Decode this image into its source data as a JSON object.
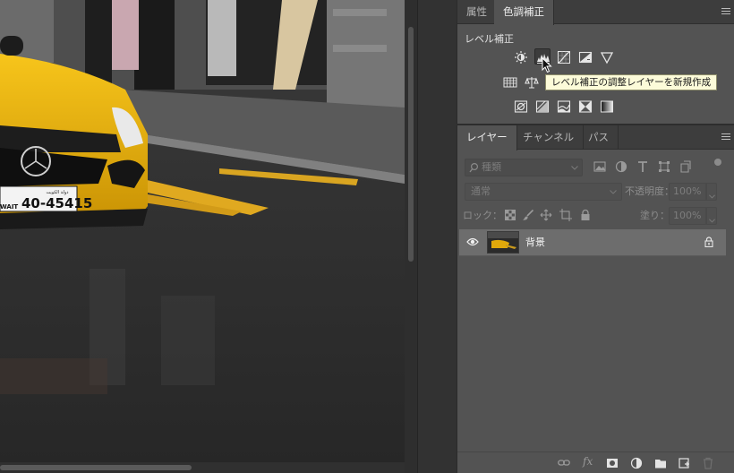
{
  "canvas": {
    "plate_text": "40-45415",
    "plate_prefix": "WAIT",
    "plate_arabic": "دولة الكويت"
  },
  "adjustments_panel": {
    "tabs": [
      {
        "label": "属性",
        "active": false
      },
      {
        "label": "色調補正",
        "active": true
      }
    ],
    "section_title": "レベル補正",
    "icons_row1": [
      "brightness-contrast-icon",
      "levels-icon",
      "curves-icon",
      "exposure-icon",
      "gradient-map-triangle-icon"
    ],
    "icons_row2": [
      "hue-saturation-icon",
      "color-balance-icon"
    ],
    "icons_row3": [
      "photo-filter-icon",
      "channel-mixer-icon",
      "color-lookup-icon",
      "invert-icon",
      "posterize-icon"
    ],
    "hovered_icon": "levels-icon",
    "tooltip": "レベル補正の調整レイヤーを新規作成"
  },
  "layers_panel": {
    "tabs": [
      {
        "label": "レイヤー",
        "active": true
      },
      {
        "label": "チャンネル",
        "active": false
      },
      {
        "label": "パス",
        "active": false
      }
    ],
    "filter_placeholder": "種類",
    "blend_mode": "通常",
    "opacity_label": "不透明度：",
    "opacity_value": "100%",
    "lock_label": "ロック：",
    "fill_label": "塗り：",
    "fill_value": "100%",
    "layers": [
      {
        "name": "背景",
        "visible": true,
        "locked": true
      }
    ],
    "footer_icons": [
      "link-layers-icon",
      "fx-icon",
      "add-mask-icon",
      "new-adjustment-layer-icon",
      "new-group-icon",
      "new-layer-icon",
      "trash-icon"
    ],
    "fx_label": "fx"
  },
  "colors": {
    "panel_bg": "#535353",
    "tab_bar_bg": "#3d3d3d",
    "tooltip_bg": "#fcfbd9",
    "layer_selected_bg": "#6d6d6d",
    "car_yellow": "#f2b705"
  }
}
